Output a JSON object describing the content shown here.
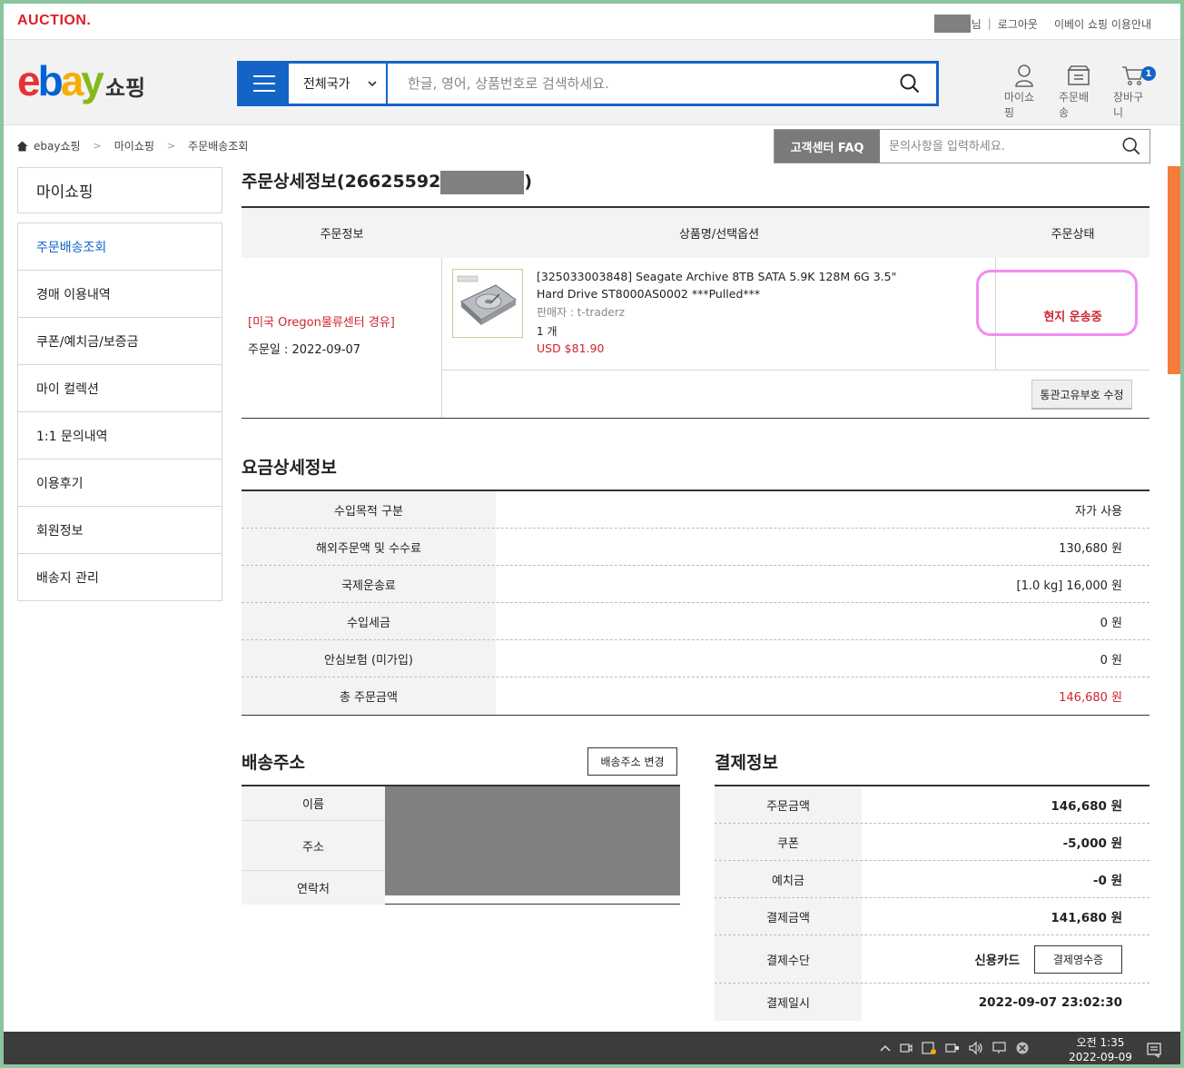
{
  "topbar": {
    "logo": "AUCTION.",
    "user_suffix": "님",
    "logout": "로그아웃",
    "guide": "이베이 쇼핑 이용안내"
  },
  "header": {
    "logo_letters": [
      "e",
      "b",
      "a",
      "y"
    ],
    "logo_colors": [
      "#e53238",
      "#0064d2",
      "#f5af02",
      "#86b817"
    ],
    "logo_shop": "쇼핑",
    "country_select": "전체국가",
    "search_placeholder": "한글, 영어, 상품번호로 검색하세요.",
    "icons": [
      {
        "label": "마이쇼핑",
        "icon": "person-icon"
      },
      {
        "label": "주문배송",
        "icon": "delivery-box-icon"
      },
      {
        "label": "장바구니",
        "icon": "cart-icon",
        "badge": "1"
      }
    ]
  },
  "breadcrumb": [
    "ebay쇼핑",
    "마이쇼핑",
    "주문배송조회"
  ],
  "faq": {
    "button": "고객센터 FAQ",
    "placeholder": "문의사항을 입력하세요."
  },
  "sidebar": {
    "title": "마이쇼핑",
    "items": [
      "주문배송조회",
      "경매 이용내역",
      "쿠폰/예치금/보증금",
      "마이 컬렉션",
      "1:1 문의내역",
      "이용후기",
      "회원정보",
      "배송지 관리"
    ],
    "active_index": 0
  },
  "order": {
    "title_prefix": "주문상세정보(26625592",
    "title_suffix": ")",
    "columns": [
      "주문정보",
      "상품명/선택옵션",
      "주문상태"
    ],
    "route": "[미국 Oregon물류센터 경유]",
    "order_date": "주문일 : 2022-09-07",
    "product_line1": "[325033003848] Seagate Archive 8TB SATA 5.9K 128M 6G 3.5\"",
    "product_line2": "Hard Drive ST8000AS0002 ***Pulled***",
    "seller": "판매자 : t-traderz",
    "qty": "1 개",
    "price": "USD $81.90",
    "status": "현지 운송중",
    "customs_button": "통관고유부호 수정"
  },
  "fees": {
    "title": "요금상세정보",
    "rows": [
      {
        "label": "수입목적 구분",
        "value": "자가 사용"
      },
      {
        "label": "해외주문액 및 수수료",
        "value": "130,680 원"
      },
      {
        "label": "국제운송료",
        "value": "[1.0 kg] 16,000 원"
      },
      {
        "label": "수입세금",
        "value": "0 원"
      },
      {
        "label": "안심보험 (미가입)",
        "value": "0 원"
      },
      {
        "label": "총 주문금액",
        "value": "146,680 원"
      }
    ]
  },
  "shipping": {
    "title": "배송주소",
    "change_button": "배송주소 변경",
    "labels": [
      "이름",
      "주소",
      "연락처"
    ]
  },
  "payment": {
    "title": "결제정보",
    "rows": [
      {
        "label": "주문금액",
        "value": "146,680 원"
      },
      {
        "label": "쿠폰",
        "value": "-5,000 원"
      },
      {
        "label": "예치금",
        "value": "-0 원"
      },
      {
        "label": "결제금액",
        "value": "141,680 원"
      },
      {
        "label": "결제수단",
        "value": "신용카드"
      },
      {
        "label": "결제일시",
        "value": "2022-09-07 23:02:30"
      }
    ],
    "receipt_button": "결제영수증"
  },
  "taskbar": {
    "time": "오전 1:35",
    "date": "2022-09-09"
  }
}
